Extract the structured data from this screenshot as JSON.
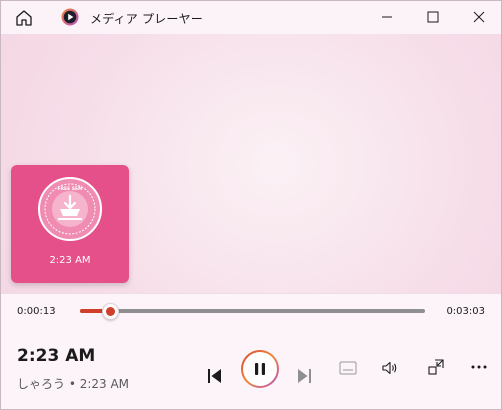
{
  "window": {
    "title": "メディア プレーヤー",
    "home_icon": "home-icon",
    "app_icon": "media-player-icon",
    "controls": [
      "minimize-icon",
      "maximize-icon",
      "close-icon"
    ]
  },
  "album": {
    "time_label": "2:23 AM",
    "art_icon": "album-art-stamp",
    "art_lettering": "FREE SEM"
  },
  "playback": {
    "current_time": "0:00:13",
    "total_time": "0:03:03",
    "progress_fraction": 0.071
  },
  "now_playing": {
    "title": "2:23 AM",
    "subtitle": "しゃろう • 2:23 AM"
  },
  "controls": {
    "previous": "previous-icon",
    "play_pause": "pause-icon",
    "next": "next-icon",
    "captions": "captions-icon",
    "volume": "volume-icon",
    "mini_player": "mini-player-icon",
    "more": "more-icon"
  },
  "colors": {
    "accent": "#d03f2a",
    "album_bg": "#e5508a",
    "background": "#f6dde8"
  }
}
